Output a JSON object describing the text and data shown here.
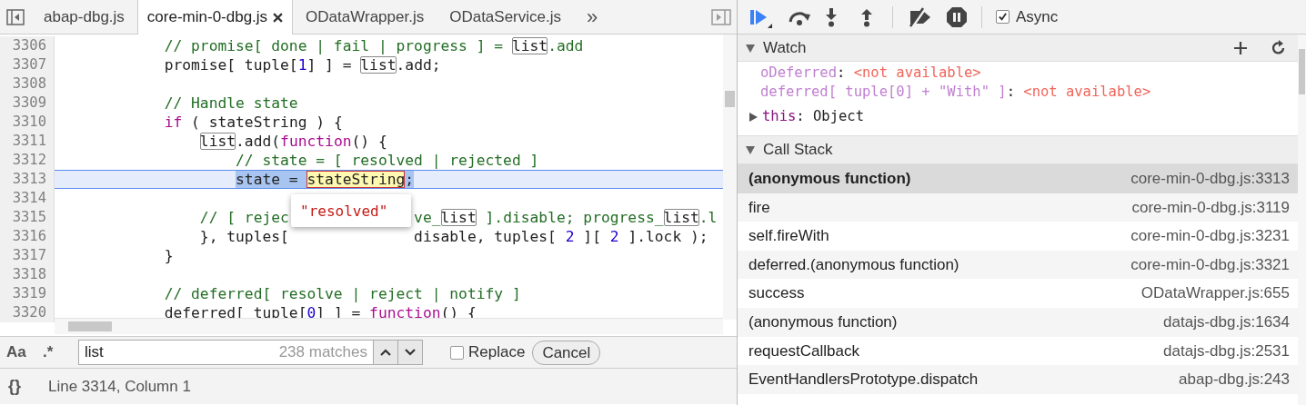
{
  "tabs": [
    {
      "label": "abap-dbg.js",
      "selected": false,
      "closable": false
    },
    {
      "label": "core-min-0-dbg.js",
      "selected": true,
      "closable": true
    },
    {
      "label": "ODataWrapper.js",
      "selected": false,
      "closable": false
    },
    {
      "label": "ODataService.js",
      "selected": false,
      "closable": false
    }
  ],
  "more_tabs": "»",
  "editor": {
    "lines": [
      {
        "number": "3306",
        "paused": false,
        "tokens": [
          {
            "kind": "comment",
            "text": "            // promise[ done | fail | progress ] = "
          },
          {
            "kind": "match",
            "text": "list"
          },
          {
            "kind": "comment",
            "text": ".add"
          }
        ]
      },
      {
        "number": "3307",
        "paused": false,
        "tokens": [
          {
            "kind": "text",
            "text": "            promise[ tuple["
          },
          {
            "kind": "number",
            "text": "1"
          },
          {
            "kind": "text",
            "text": "] ] = "
          },
          {
            "kind": "match",
            "text": "list"
          },
          {
            "kind": "text",
            "text": ".add;"
          }
        ]
      },
      {
        "number": "3308",
        "paused": false
      },
      {
        "number": "3309",
        "paused": false,
        "tokens": [
          {
            "kind": "comment",
            "text": "            // Handle state"
          }
        ]
      },
      {
        "number": "3310",
        "paused": false,
        "tokens": [
          {
            "kind": "keyword",
            "text": "            if"
          },
          {
            "kind": "text",
            "text": " ( stateString ) {"
          }
        ]
      },
      {
        "number": "3311",
        "paused": false,
        "tokens": [
          {
            "kind": "match",
            "text": "                list"
          },
          {
            "kind": "text",
            "text": ".add("
          },
          {
            "kind": "keyword",
            "text": "function"
          },
          {
            "kind": "text",
            "text": "() {"
          }
        ]
      },
      {
        "number": "3312",
        "paused": false,
        "tokens": [
          {
            "kind": "comment",
            "text": "                    // state = [ resolved | rejected ]"
          }
        ]
      },
      {
        "number": "3313",
        "paused": true,
        "tokens": [
          {
            "kind": "selection",
            "text": "                    state = "
          },
          {
            "kind": "current",
            "text": "stateString"
          },
          {
            "kind": "selection",
            "text": ";"
          }
        ]
      },
      {
        "number": "3314",
        "paused": false
      },
      {
        "number": "3315",
        "paused": false,
        "tokens": [
          {
            "kind": "comment",
            "text": "                // [ rejec"
          },
          {
            "kind": "comment",
            "text": "              ve_"
          },
          {
            "kind": "match",
            "text": "list"
          },
          {
            "kind": "comment",
            "text": " ].disable; progress_"
          },
          {
            "kind": "match",
            "text": "list"
          },
          {
            "kind": "comment",
            "text": ".l"
          }
        ]
      },
      {
        "number": "3316",
        "paused": false,
        "tokens": [
          {
            "kind": "text",
            "text": "                }, tuples["
          },
          {
            "kind": "text",
            "text": "              disable, tuples[ "
          },
          {
            "kind": "number",
            "text": "2"
          },
          {
            "kind": "text",
            "text": " ][ "
          },
          {
            "kind": "number",
            "text": "2"
          },
          {
            "kind": "text",
            "text": " ].lock );"
          }
        ]
      },
      {
        "number": "3317",
        "paused": false,
        "tokens": [
          {
            "kind": "text",
            "text": "            }"
          }
        ]
      },
      {
        "number": "3318",
        "paused": false
      },
      {
        "number": "3319",
        "paused": false,
        "tokens": [
          {
            "kind": "comment",
            "text": "            // deferred[ resolve | reject | notify ]"
          }
        ]
      },
      {
        "number": "3320",
        "paused": false,
        "tokens": [
          {
            "kind": "text",
            "text": "            deferred[ tuple["
          },
          {
            "kind": "number",
            "text": "0"
          },
          {
            "kind": "text",
            "text": "] ] = "
          },
          {
            "kind": "keyword",
            "text": "function"
          },
          {
            "kind": "text",
            "text": "() {"
          }
        ]
      }
    ],
    "tooltip": "\"resolved\""
  },
  "search": {
    "case_label": "Aa",
    "regex_label": ".*",
    "value": "list",
    "count": "238 matches",
    "replace_label": "Replace",
    "replace_checked": false,
    "cancel": "Cancel"
  },
  "status_bar": {
    "format_label": "{}",
    "position": "Line 3314, Column 1"
  },
  "debugger": {
    "async_label": "Async",
    "async_checked": true,
    "watch": {
      "title": "Watch",
      "expanded": true,
      "items": [
        {
          "kind": "value",
          "name": "oDeferred",
          "separator": ":",
          "value": "<not available>"
        },
        {
          "kind": "value",
          "name": "deferred[ tuple[0] + \"With\" ]",
          "separator": ":",
          "value": "<not available>"
        },
        {
          "kind": "object",
          "name": "this",
          "separator": ":",
          "value": "Object"
        }
      ]
    },
    "call_stack": {
      "title": "Call Stack",
      "expanded": true,
      "frames": [
        {
          "function": "(anonymous function)",
          "location": "core-min-0-dbg.js:3313",
          "selected": true
        },
        {
          "function": "fire",
          "location": "core-min-0-dbg.js:3119",
          "selected": false
        },
        {
          "function": "self.fireWith",
          "location": "core-min-0-dbg.js:3231",
          "selected": false
        },
        {
          "function": "deferred.(anonymous function)",
          "location": "core-min-0-dbg.js:3321",
          "selected": false
        },
        {
          "function": "success",
          "location": "ODataWrapper.js:655",
          "selected": false
        },
        {
          "function": "(anonymous function)",
          "location": "datajs-dbg.js:1634",
          "selected": false
        },
        {
          "function": "requestCallback",
          "location": "datajs-dbg.js:2531",
          "selected": false
        },
        {
          "function": "EventHandlersPrototype.dispatch",
          "location": "abap-dbg.js:243",
          "selected": false
        }
      ]
    }
  }
}
